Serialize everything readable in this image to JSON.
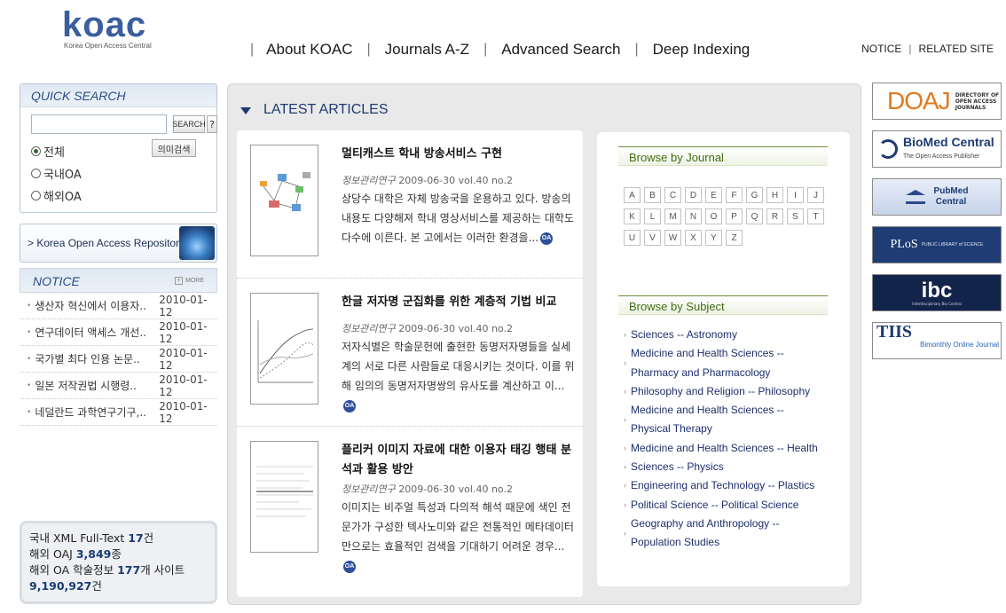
{
  "header": {
    "logo_text": "koac",
    "logo_subtitle": "Korea Open Access Central",
    "nav": [
      "About KOAC",
      "Journals A-Z",
      "Advanced Search",
      "Deep Indexing"
    ],
    "util_links": [
      "NOTICE",
      "RELATED SITE"
    ]
  },
  "quick_search": {
    "title": "QUICK SEARCH",
    "search_button": "SEARCH",
    "help_button": "?",
    "options": [
      "전체",
      "국내OA",
      "해외OA"
    ],
    "selected": "전체",
    "semantic_button": "의미검색"
  },
  "repository_banner": "Korea Open Access Repository",
  "notice": {
    "title": "NOTICE",
    "more": "MORE",
    "items": [
      {
        "title": "생산자 혁신에서 이용자..",
        "date": "2010-01-12"
      },
      {
        "title": "연구데이터 액세스 개선..",
        "date": "2010-01-12"
      },
      {
        "title": "국가별 최다 인용 논문..",
        "date": "2010-01-12"
      },
      {
        "title": "일본 저작권법 시행령..",
        "date": "2010-01-12"
      },
      {
        "title": "네덜란드 과학연구기구,..",
        "date": "2010-01-12"
      }
    ]
  },
  "stats": {
    "line1_prefix": "국내 XML Full-Text ",
    "line1_value": "17",
    "line1_suffix": "건",
    "line2_prefix": "해외 OAJ ",
    "line2_value": "3,849",
    "line2_suffix": "종",
    "line3_prefix": "해외 OA 학술정보 ",
    "line3_value": "177",
    "line3_suffix": "개 사이트",
    "line4_value": "9,190,927",
    "line4_suffix": "건"
  },
  "latest": {
    "title": "LATEST ARTICLES",
    "articles": [
      {
        "title": "멀티캐스트 학내 방송서비스 구현",
        "journal": "정보관리연구",
        "meta": "2009-06-30 vol.40 no.2",
        "snippet": "상당수 대학은 자체 방송국을 운용하고 있다. 방송의 내용도 다양해져 학내 영상서비스를 제공하는 대학도 다수에 이른다. 본 고에서는 이러한 환경을...",
        "badge": "OA"
      },
      {
        "title": "한글 저자명 군집화를 위한 계층적 기법 비교",
        "journal": "정보관리연구",
        "meta": "2009-06-30 vol.40 no.2",
        "snippet": "저자식별은 학술문헌에 출현한 동명저자명들을 실세계의 서로 다른 사람들로 대응시키는 것이다. 이를 위해 임의의 동명저자명쌍의 유사도를 계산하고 이...",
        "badge": "OA"
      },
      {
        "title": "플리커 이미지 자료에 대한 이용자 태깅 행태 분석과 활용 방안",
        "journal": "정보관리연구",
        "meta": "2009-06-30 vol.40 no.2",
        "snippet": "이미지는 비주얼 특성과 다의적 해석 때문에 색인 전문가가 구성한 텍사노미와 같은 전통적인 메타데이터만으로는 효율적인 검색을 기대하기 어려운 경우...",
        "badge": "OA"
      }
    ]
  },
  "browse_journal": {
    "title": "Browse by Journal",
    "letters": [
      "A",
      "B",
      "C",
      "D",
      "E",
      "F",
      "G",
      "H",
      "I",
      "J",
      "K",
      "L",
      "M",
      "N",
      "O",
      "P",
      "Q",
      "R",
      "S",
      "T",
      "U",
      "V",
      "W",
      "X",
      "Y",
      "Z"
    ]
  },
  "browse_subject": {
    "title": "Browse by Subject",
    "items": [
      [
        "Sciences -- Astronomy"
      ],
      [
        "Medicine and Health Sciences --",
        "Pharmacy and Pharmacology"
      ],
      [
        "Philosophy and Religion -- Philosophy"
      ],
      [
        "Medicine and Health Sciences --",
        "Physical Therapy"
      ],
      [
        "Medicine and Health Sciences -- Health"
      ],
      [
        "Sciences -- Physics"
      ],
      [
        "Engineering and Technology -- Plastics"
      ],
      [
        "Political Science -- Political Science"
      ],
      [
        "Geography and Anthropology --",
        "Population Studies"
      ]
    ]
  },
  "banners": {
    "doaj_big": "DOAJ",
    "doaj_small": [
      "DIRECTORY OF",
      "OPEN ACCESS",
      "JOURNALS"
    ],
    "biomed_main": "BioMed Central",
    "biomed_sub": "The Open Access Publisher",
    "pubmed": [
      "PubMed",
      "Central"
    ],
    "plos_main": "PLoS",
    "plos_sub": "PUBLIC LIBRARY of SCIENCE",
    "ibc_main": "ibc",
    "ibc_sub": "Interdisciplinary Bio Central",
    "tiis_main": "TIIS",
    "tiis_sub": "Bimonthly Online Journal"
  },
  "colors": {
    "brand": "#3a5e9e",
    "heading_blue": "#1d3b73",
    "browse_green": "#3f6d14",
    "panel_bg": "#e9e9e9"
  }
}
